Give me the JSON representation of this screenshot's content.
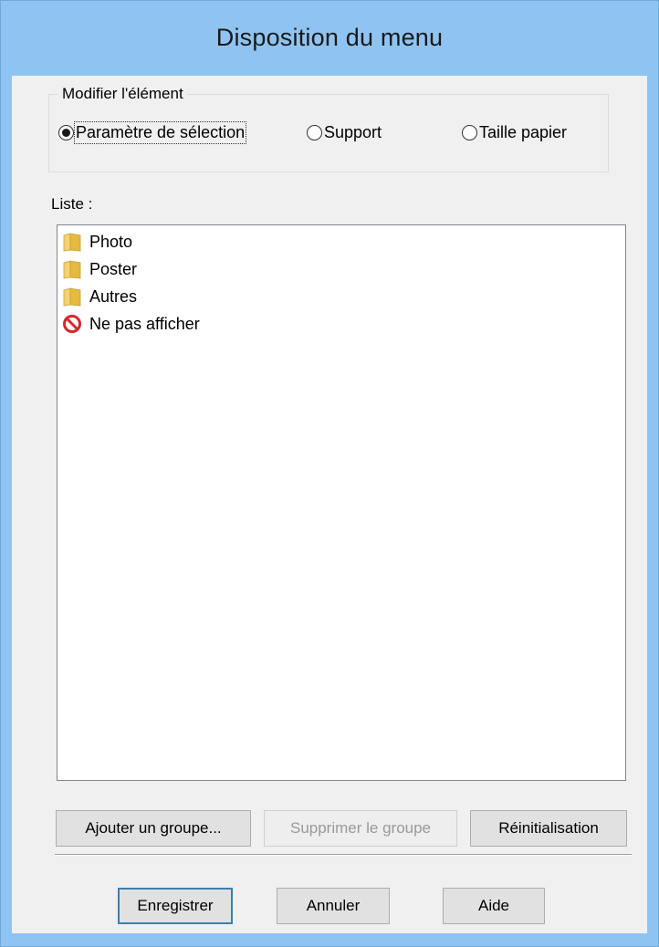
{
  "window": {
    "title": "Disposition du menu"
  },
  "modify_group": {
    "legend": "Modifier l'élément",
    "options": [
      {
        "label": "Paramètre de sélection",
        "checked": true
      },
      {
        "label": "Support",
        "checked": false
      },
      {
        "label": "Taille papier",
        "checked": false
      }
    ]
  },
  "list": {
    "label": "Liste :",
    "items": [
      {
        "label": "Photo",
        "icon": "folder-icon"
      },
      {
        "label": "Poster",
        "icon": "folder-icon"
      },
      {
        "label": "Autres",
        "icon": "folder-icon"
      },
      {
        "label": "Ne pas afficher",
        "icon": "no-entry-icon"
      }
    ]
  },
  "group_buttons": {
    "add": "Ajouter un groupe...",
    "remove": "Supprimer le groupe",
    "reset": "Réinitialisation"
  },
  "footer_buttons": {
    "save": "Enregistrer",
    "cancel": "Annuler",
    "help": "Aide"
  },
  "colors": {
    "titlebar": "#8fc4f2",
    "client": "#f0f0f0",
    "folder": "#e8c04f",
    "no_entry": "#d9262b"
  }
}
